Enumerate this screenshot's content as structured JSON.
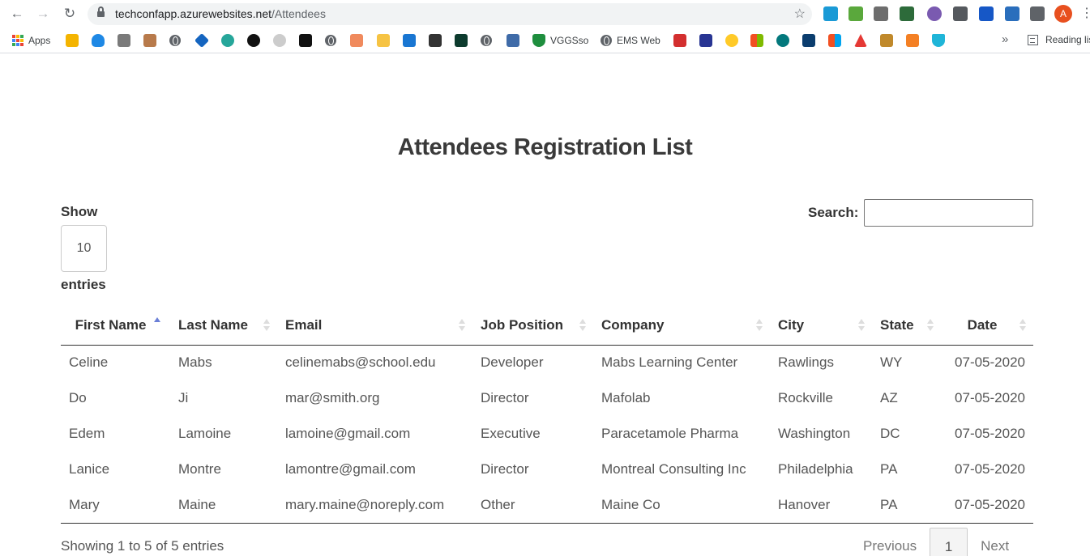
{
  "browser": {
    "url_host": "techconfapp.azurewebsites.net",
    "url_path": "/Attendees",
    "profile_initial": "A",
    "bookmarks": [
      {
        "label": "Apps"
      },
      {
        "label": "VGGSso"
      },
      {
        "label": "EMS Web"
      }
    ],
    "reading_list": "Reading lis"
  },
  "page": {
    "title": "Attendees Registration List"
  },
  "controls": {
    "show_label": "Show",
    "length_value": "10",
    "entries_label": "entries",
    "search_label": "Search:",
    "search_value": ""
  },
  "table": {
    "headers": [
      "First Name",
      "Last Name",
      "Email",
      "Job Position",
      "Company",
      "City",
      "State",
      "Date"
    ],
    "rows": [
      {
        "first": "Celine",
        "last": "Mabs",
        "email": "celinemabs@school.edu",
        "job": "Developer",
        "company": "Mabs Learning Center",
        "city": "Rawlings",
        "state": "WY",
        "date": "07-05-2020"
      },
      {
        "first": "Do",
        "last": "Ji",
        "email": "mar@smith.org",
        "job": "Director",
        "company": "Mafolab",
        "city": "Rockville",
        "state": "AZ",
        "date": "07-05-2020"
      },
      {
        "first": "Edem",
        "last": "Lamoine",
        "email": "lamoine@gmail.com",
        "job": "Executive",
        "company": "Paracetamole Pharma",
        "city": "Washington",
        "state": "DC",
        "date": "07-05-2020"
      },
      {
        "first": "Lanice",
        "last": "Montre",
        "email": "lamontre@gmail.com",
        "job": "Director",
        "company": "Montreal Consulting Inc",
        "city": "Philadelphia",
        "state": "PA",
        "date": "07-05-2020"
      },
      {
        "first": "Mary",
        "last": "Maine",
        "email": "mary.maine@noreply.com",
        "job": "Other",
        "company": "Maine Co",
        "city": "Hanover",
        "state": "PA",
        "date": "07-05-2020"
      }
    ]
  },
  "footer": {
    "info": "Showing 1 to 5 of 5 entries",
    "previous": "Previous",
    "current_page": "1",
    "next": "Next"
  }
}
